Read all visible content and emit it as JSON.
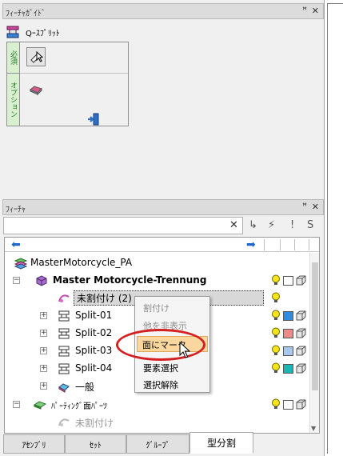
{
  "feature_guide": {
    "title": "ﾌｨｰﾁｬｶﾞｲﾄﾞ",
    "pin": "ꟸ",
    "close": "✕",
    "tool_label": "Qｰｽﾌﾟﾘｯﾄ",
    "required_label": "必須",
    "option_label": "オプション"
  },
  "features": {
    "title": "ﾌｨｰﾁｬ",
    "pin": "ꟸ",
    "close": "✕",
    "search_value": "",
    "clear_glyph": "✕",
    "toolbar_glyphs": [
      "↳",
      "⚡",
      "!",
      "S"
    ]
  },
  "tree": {
    "root": "MasterMotorcycle_PA",
    "items": [
      {
        "label": "Master Motorcycle-Trennung",
        "expander": "−",
        "bold": true
      },
      {
        "label": "未割付け (2)",
        "selected": true
      },
      {
        "label": "Split-01",
        "expander": "+",
        "color": "#2e8de0"
      },
      {
        "label": "Split-02",
        "expander": "+",
        "color": "#f08a8a"
      },
      {
        "label": "Split-03",
        "expander": "+",
        "color": "#a9c7ec"
      },
      {
        "label": "Split-04",
        "expander": "+",
        "color": "#16b9b4"
      },
      {
        "label": "一般",
        "expander": "+"
      },
      {
        "label": "ﾊﾟｰﾃｨﾝｸﾞ面ﾊﾟｰﾂ",
        "expander": "−"
      },
      {
        "label": "未割付け",
        "muted": true
      }
    ]
  },
  "context_menu": {
    "items": [
      {
        "label": "割付け",
        "disabled": true
      },
      {
        "label": "他を非表示",
        "disabled": true
      },
      {
        "label": "面にマーク",
        "highlighted": true
      },
      {
        "label": "要素選択",
        "disabled": false
      },
      {
        "label": "選択解除",
        "disabled": false
      }
    ]
  },
  "tabs": {
    "items": [
      "ｱｾﾝﾌﾞﾘ",
      "ｾｯﾄ",
      "ｸﾞﾙｰﾌﾟ",
      "型分割"
    ],
    "active": "型分割"
  }
}
